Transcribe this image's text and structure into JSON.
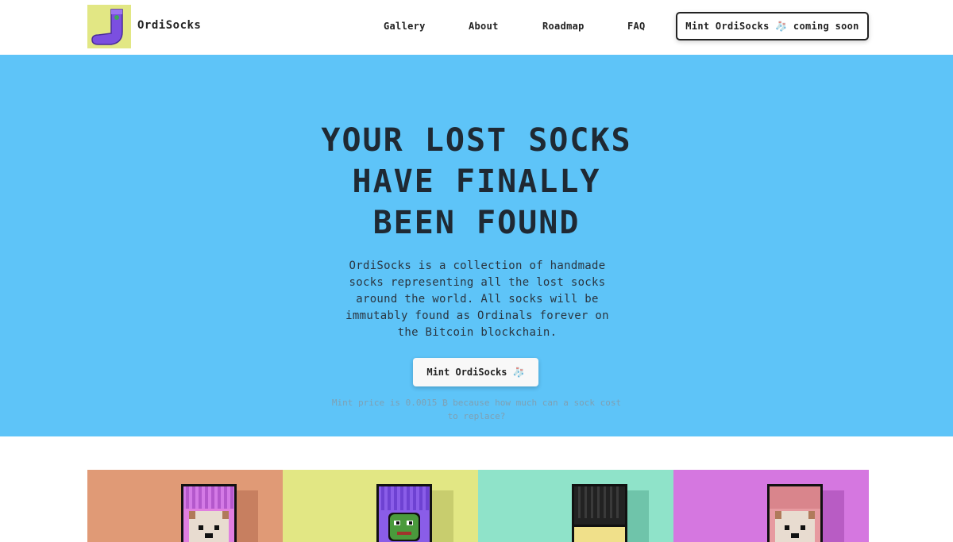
{
  "nav": {
    "brand": "OrdiSocks",
    "links": [
      "Gallery",
      "About",
      "Roadmap",
      "FAQ"
    ],
    "mint_button": "Mint OrdiSocks 🧦 coming soon",
    "logo_icon": "sock-icon"
  },
  "hero": {
    "title": "YOUR LOST SOCKS\nHAVE FINALLY\nBEEN FOUND",
    "description": "OrdiSocks is a collection of handmade socks representing all the lost socks around the world. All socks will be immutably found as Ordinals forever on the Bitcoin blockchain.",
    "mint_button": "Mint OrdiSocks 🧦",
    "price_note": "Mint price is 0.0015 ₿ because how much can a sock cost to replace?"
  },
  "gallery": {
    "tiles": [
      {
        "bg": "#e09a76",
        "sock": "#e07fe0",
        "stripe": "#c95ed6",
        "face": "doge"
      },
      {
        "bg": "#e2e784",
        "sock": "#8a5de8",
        "stripe": "#6e42d2",
        "face": "pepe"
      },
      {
        "bg": "#8fe3c9",
        "sock": "#222222",
        "stripe": "#111111",
        "face": "plain"
      },
      {
        "bg": "#d577e0",
        "sock": "#e79aa0",
        "stripe": "#d9858c",
        "face": "doge"
      }
    ]
  },
  "colors": {
    "hero_bg": "#5ec4f8",
    "text": "#1f2933",
    "accent_logo_bg": "#e2e784"
  }
}
